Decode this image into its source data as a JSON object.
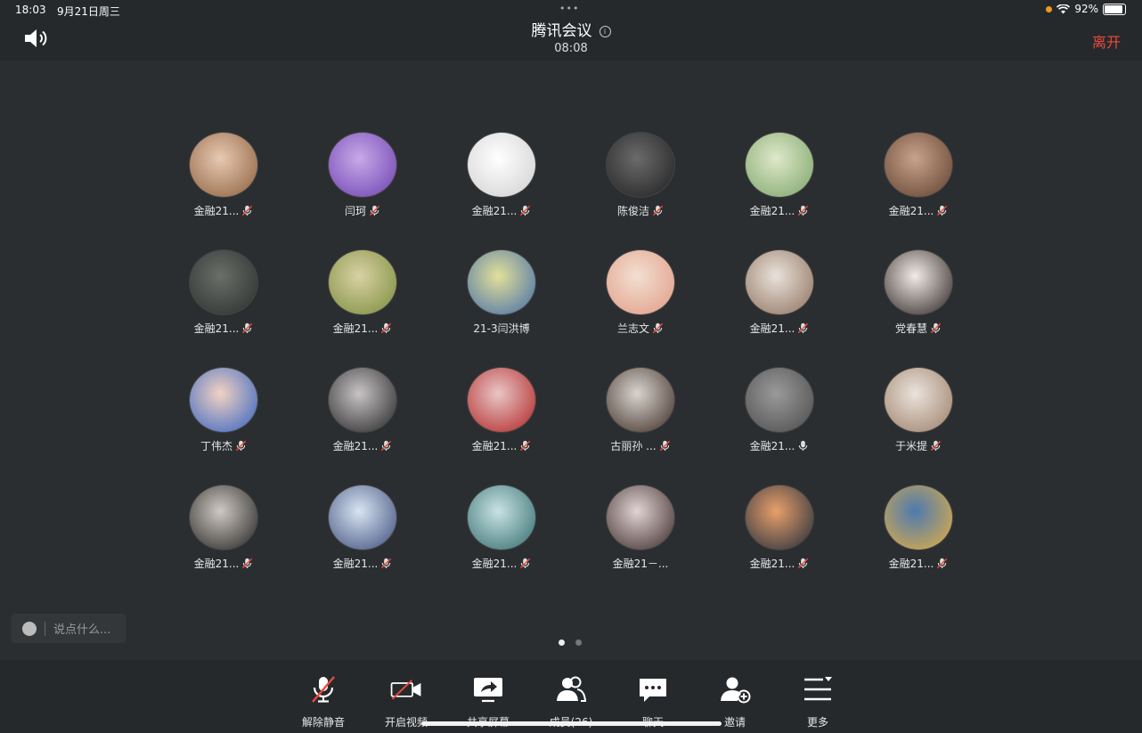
{
  "status_bar": {
    "time": "18:03",
    "date": "9月21日周三",
    "battery": "92%",
    "dots": "•••"
  },
  "header": {
    "title": "腾讯会议",
    "timer": "08:08",
    "leave_label": "离开",
    "info_glyph": "i"
  },
  "participants": [
    {
      "name": "金融21...",
      "mic": "muted",
      "avatar": [
        "#e8c9b2",
        "#8a5d3b"
      ]
    },
    {
      "name": "闫珂",
      "mic": "muted",
      "avatar": [
        "#c9a9e8",
        "#6a3fb0"
      ]
    },
    {
      "name": "金融21...",
      "mic": "muted",
      "avatar": [
        "#ffffff",
        "#cfcfcf"
      ]
    },
    {
      "name": "陈俊洁",
      "mic": "muted",
      "avatar": [
        "#6b6b6b",
        "#1f1f1f"
      ]
    },
    {
      "name": "金融21...",
      "mic": "muted",
      "avatar": [
        "#dfe8c9",
        "#7aa368"
      ]
    },
    {
      "name": "金融21...",
      "mic": "muted",
      "avatar": [
        "#c9a28a",
        "#5d3f2e"
      ]
    },
    {
      "name": "金融21...",
      "mic": "muted",
      "avatar": [
        "#6a6f6a",
        "#2a2d2a"
      ]
    },
    {
      "name": "金融21...",
      "mic": "muted",
      "avatar": [
        "#d8d2a4",
        "#7a8a3a"
      ]
    },
    {
      "name": "21-3闫洪博",
      "mic": "none",
      "avatar": [
        "#e3e09a",
        "#3f6aa8"
      ]
    },
    {
      "name": "兰志文",
      "mic": "muted",
      "avatar": [
        "#f3dfd1",
        "#e09a84"
      ]
    },
    {
      "name": "金融21...",
      "mic": "muted",
      "avatar": [
        "#e9e2da",
        "#8c6e5a"
      ]
    },
    {
      "name": "党春慧",
      "mic": "muted",
      "avatar": [
        "#f1ece6",
        "#2a2020"
      ]
    },
    {
      "name": "丁伟杰",
      "mic": "muted",
      "avatar": [
        "#f2d2c2",
        "#2e5fc1"
      ]
    },
    {
      "name": "金融21...",
      "mic": "muted",
      "avatar": [
        "#c8c4c6",
        "#222222"
      ]
    },
    {
      "name": "金融21...",
      "mic": "muted",
      "avatar": [
        "#e8c6c6",
        "#b02020"
      ]
    },
    {
      "name": "古丽孙 ...",
      "mic": "muted",
      "avatar": [
        "#d9d4ce",
        "#3a2a22"
      ]
    },
    {
      "name": "金融21...",
      "mic": "on",
      "avatar": [
        "#9a9a9a",
        "#4a4a4a"
      ]
    },
    {
      "name": "于米提",
      "mic": "muted",
      "avatar": [
        "#eae3dc",
        "#9a7c64"
      ]
    },
    {
      "name": "金融21...",
      "mic": "muted",
      "avatar": [
        "#cfc9c2",
        "#1f1f1f"
      ]
    },
    {
      "name": "金融21...",
      "mic": "muted",
      "avatar": [
        "#d9e4f2",
        "#3a4a7a"
      ]
    },
    {
      "name": "金融21...",
      "mic": "muted",
      "avatar": [
        "#c9e2e4",
        "#2f6a6a"
      ]
    },
    {
      "name": "金融21－...",
      "mic": "none",
      "avatar": [
        "#e0d4d4",
        "#3a2626"
      ]
    },
    {
      "name": "金融21...",
      "mic": "muted",
      "avatar": [
        "#e8a06a",
        "#1e2a3a"
      ]
    },
    {
      "name": "金融21...",
      "mic": "muted",
      "avatar": [
        "#4d7ab0",
        "#e8b040"
      ]
    }
  ],
  "chat": {
    "placeholder": "说点什么..."
  },
  "pager": {
    "total": 2,
    "active": 0
  },
  "toolbar": [
    {
      "key": "unmute",
      "label": "解除静音",
      "icon": "mic-off-icon"
    },
    {
      "key": "start-video",
      "label": "开启视频",
      "icon": "video-off-icon"
    },
    {
      "key": "share-screen",
      "label": "共享屏幕",
      "icon": "share-screen-icon"
    },
    {
      "key": "members",
      "label": "成员(26)",
      "icon": "members-icon"
    },
    {
      "key": "chat",
      "label": "聊天",
      "icon": "chat-icon"
    },
    {
      "key": "invite",
      "label": "邀请",
      "icon": "invite-icon"
    },
    {
      "key": "more",
      "label": "更多",
      "icon": "more-icon"
    }
  ],
  "colors": {
    "leave": "#e94b3c",
    "muted_slash": "#e94b3c",
    "background": "#2b2e31",
    "bar": "#26292c"
  }
}
